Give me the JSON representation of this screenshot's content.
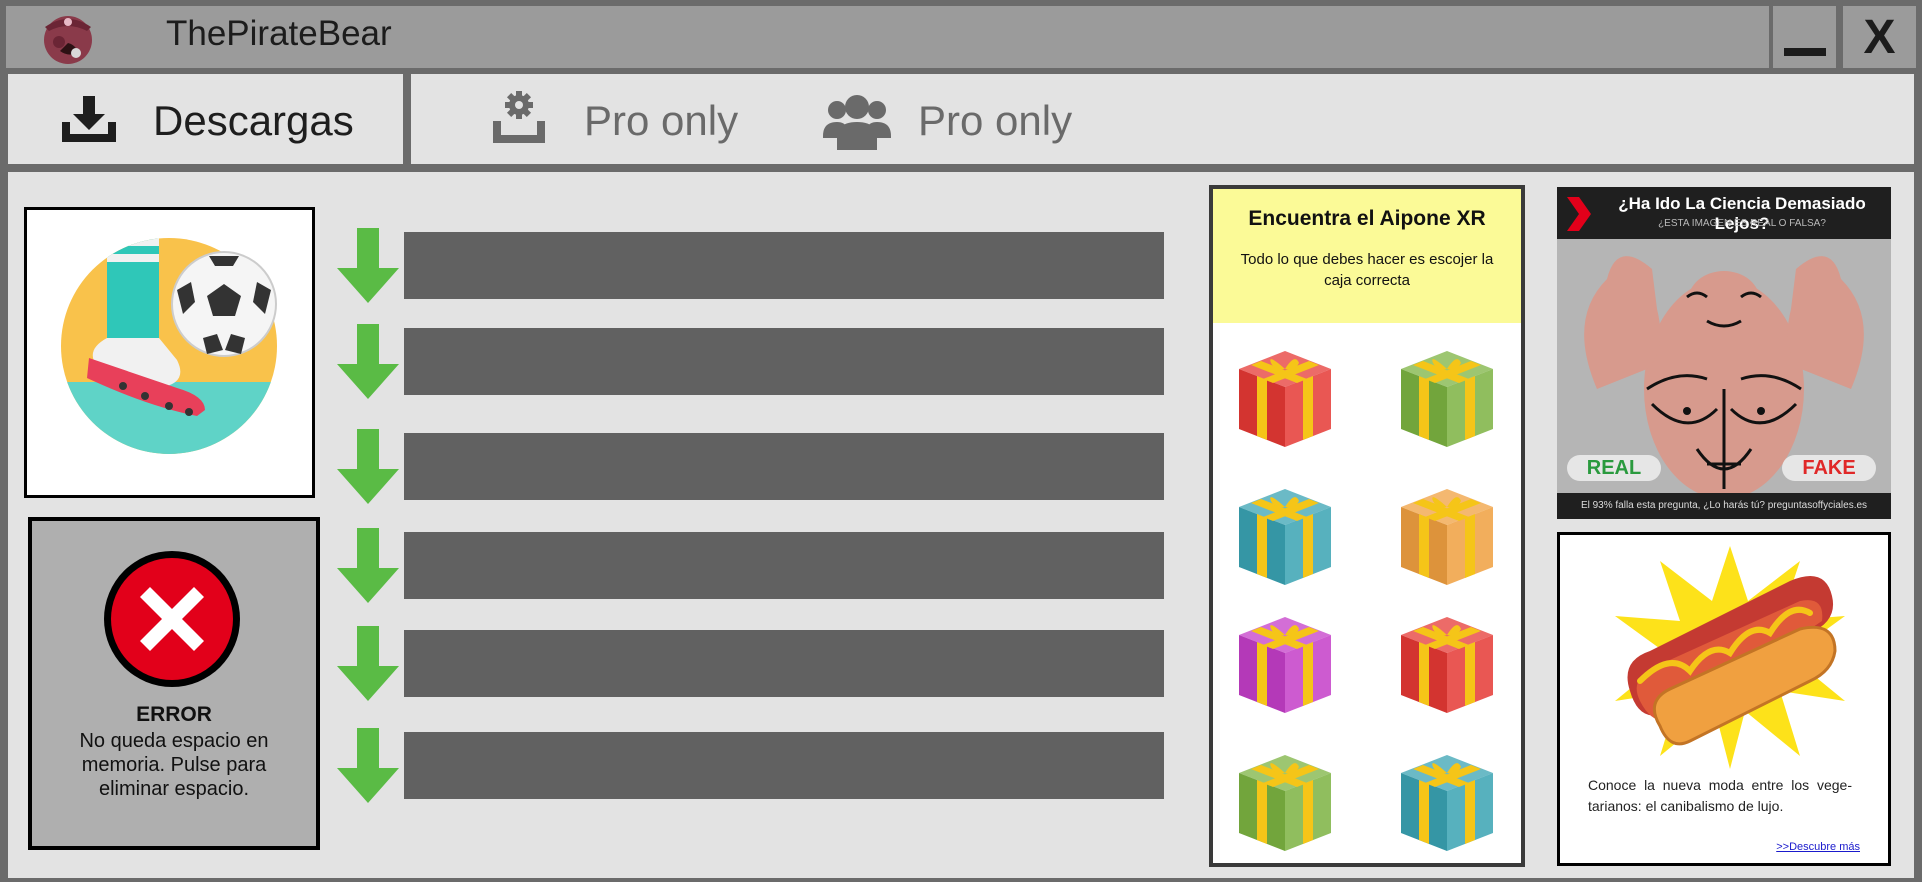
{
  "window": {
    "title": "ThePirateBear",
    "minimize_icon": "minimize-icon",
    "close_label": "X"
  },
  "tabs": [
    {
      "label": "Descargas",
      "icon": "download-icon"
    },
    {
      "label": "Pro only",
      "icon": "gear-icon"
    },
    {
      "label": "Pro only",
      "icon": "users-icon"
    }
  ],
  "download_rows": [
    {
      "icon": "download-arrow-icon"
    },
    {
      "icon": "download-arrow-icon"
    },
    {
      "icon": "download-arrow-icon"
    },
    {
      "icon": "download-arrow-icon"
    },
    {
      "icon": "download-arrow-icon"
    },
    {
      "icon": "download-arrow-icon"
    }
  ],
  "error": {
    "title": "ERROR",
    "message": "No queda espacio en memoria. Pulse para eliminar espacio."
  },
  "game_ad": {
    "title": "Encuentra el Aipone XR",
    "subtitle": "Todo lo que debes hacer es escojer la caja correcta",
    "gifts": [
      "red",
      "green",
      "teal",
      "orange",
      "magenta",
      "red",
      "green",
      "teal"
    ],
    "gift_colors": {
      "red": "#e53935",
      "green": "#7cb342",
      "teal": "#3aa3b3",
      "orange": "#f0a040",
      "magenta": "#c43ec8"
    },
    "ribbon_color": "#f5c518"
  },
  "ad_science": {
    "title": "¿Ha Ido La Ciencia Demasiado Lejos?",
    "subtitle": "¿ESTA IMAGEN ES REAL O FALSA?",
    "real_label": "REAL",
    "fake_label": "FAKE",
    "footer": "El 93% falla esta pregunta, ¿Lo harás tú? preguntasoffyciales.es"
  },
  "ad_hotdog": {
    "text": "Conoce la nueva moda entre los vege-tarianos: el canibalismo de lujo.",
    "link": ">>Descubre más"
  },
  "colors": {
    "accent_green": "#5abb45",
    "error_red": "#e2001a",
    "bar_gray": "#616161"
  }
}
